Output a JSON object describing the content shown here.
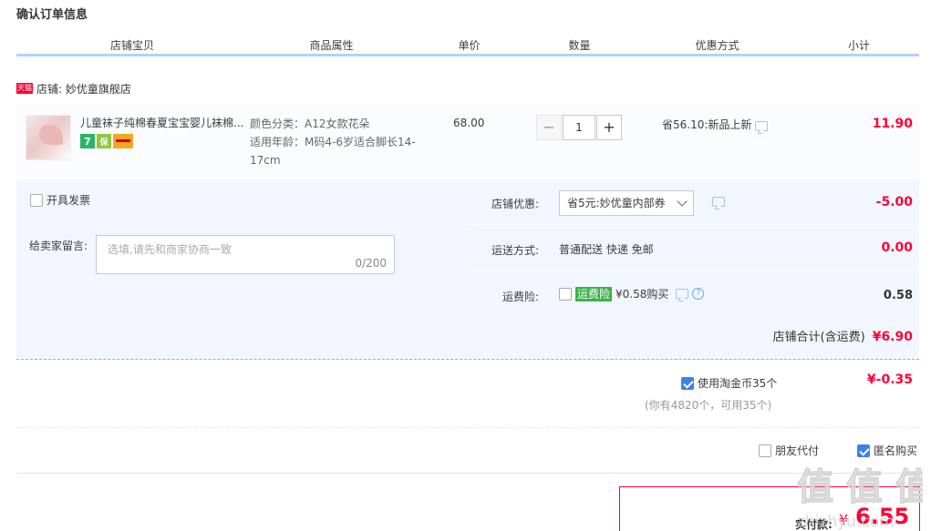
{
  "page": {
    "title": "确认订单信息"
  },
  "columns": [
    "店铺宝贝",
    "商品属性",
    "单价",
    "数量",
    "优惠方式",
    "小计"
  ],
  "shop": {
    "badge": "天猫",
    "name_label": "店铺: 妙优童旗舰店"
  },
  "item": {
    "title": "儿童袜子纯棉春夏宝宝婴儿袜棉...",
    "badges": [
      "7",
      "保",
      "card"
    ],
    "attr_color": "颜色分类：A12女款花朵",
    "attr_age": "适用年龄：M码4-6岁适合脚长14-17cm",
    "price": "68.00",
    "quantity": "1",
    "minus": "−",
    "plus": "+",
    "discount": "省56.10:新品上新",
    "subtotal": "11.90"
  },
  "panel": {
    "invoice_label": "开具发票",
    "memo_label": "给卖家留言:",
    "memo_placeholder": "选填,请先和商家协商一致",
    "memo_count": "0/200",
    "shop_discount_label": "店铺优惠:",
    "shop_discount_value": "省5元:妙优童内部券",
    "shop_discount_amount": "-5.00",
    "shipping_label": "运送方式:",
    "shipping_value": "普通配送 快递 免邮",
    "shipping_amount": "0.00",
    "insurance_label": "运费险:",
    "insurance_tag": "运费险",
    "insurance_text": "¥0.58购买",
    "insurance_amount": "0.58",
    "shop_total_label": "店铺合计(含运费)",
    "shop_total_value": "¥6.90"
  },
  "coins": {
    "label": "使用淘金币35个",
    "note": "(你有4820个，可用35个)",
    "amount": "¥-0.35",
    "checked": true
  },
  "options": {
    "friend_pay": "朋友代付",
    "anonymous": "匿名购买",
    "anonymous_checked": true
  },
  "payment": {
    "label": "实付款:",
    "currency": "¥",
    "amount": "6.55"
  },
  "watermark": {
    "text": "值 值 值",
    "url": "zhizhyu.com"
  },
  "colors": {
    "accent_red": "#ff0036",
    "header_blue": "#b2d1ff",
    "panel_bg": "#f2f7ff",
    "check_blue": "#3d81ed"
  }
}
